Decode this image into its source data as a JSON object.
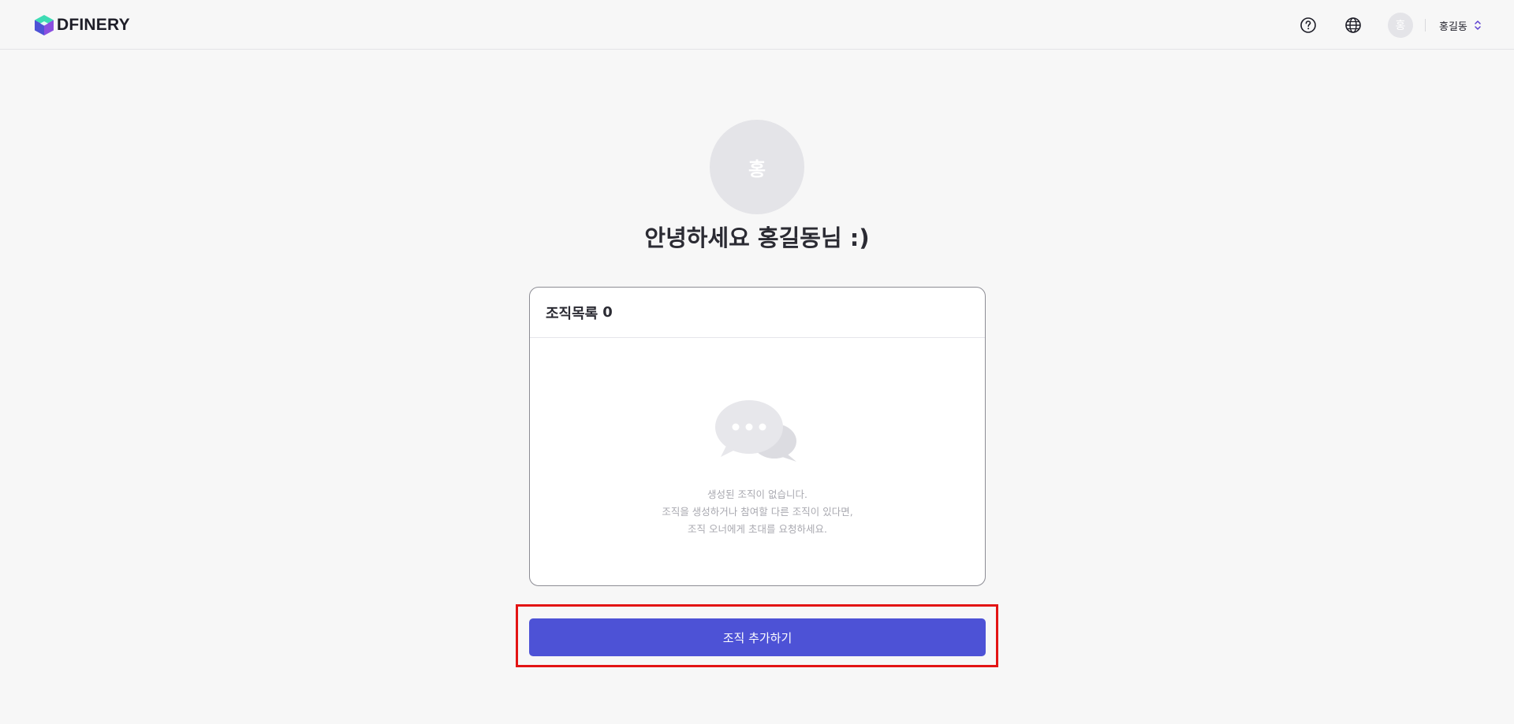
{
  "header": {
    "logo_text_d": "D",
    "logo_text_rest": "FINERY",
    "help_icon": "help-circle-icon",
    "language_icon": "globe-icon",
    "avatar_initial": "홍",
    "user_name": "홍길동",
    "user_menu_icon": "chevron-up-down-icon"
  },
  "profile": {
    "avatar_initial": "홍",
    "greeting": "안녕하세요 홍길동님 :)"
  },
  "org_list": {
    "title": "조직목록",
    "count": "0",
    "empty_icon": "chat-bubbles-icon",
    "empty_line1": "생성된 조직이 없습니다.",
    "empty_line2": "조직을 생성하거나 참여할 다른 조직이 있다면,",
    "empty_line3": "조직 오너에게 초대를 요청하세요."
  },
  "actions": {
    "add_org_label": "조직 추가하기"
  },
  "colors": {
    "accent": "#4d52d6",
    "highlight_frame": "#e31414",
    "logo_cube_top": "#3ddbb4",
    "logo_cube_left": "#4d52d6",
    "logo_cube_right": "#8a4fe0"
  }
}
